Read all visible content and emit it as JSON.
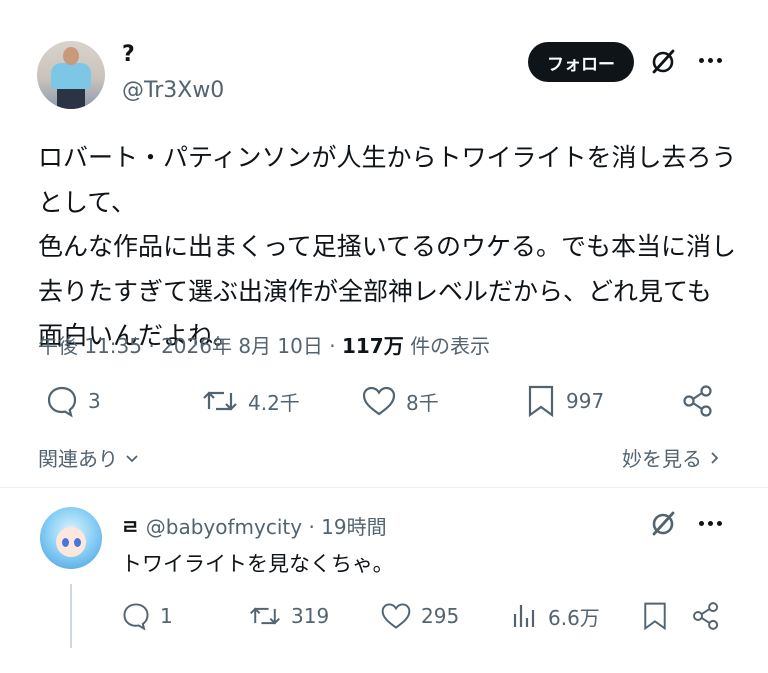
{
  "tweet": {
    "author_name": "?",
    "author_handle": "@Tr3Xw0",
    "follow_label": "フォロー",
    "text": "ロバート・パティンソンが人生からトワイライトを消し去ろうとして、\n色んな作品に出まくって足掻いてるのウケる。でも本当に消し\n去りたすぎて選ぶ出演作が全部神レベルだから、どれ見ても\n面白いんだよね。",
    "time": "午後 11:35",
    "date": "2026年 8月 10日",
    "views_count": "117万",
    "views_label": "件の表示",
    "actions": {
      "replies": "3",
      "reposts": "4.2千",
      "likes": "8千",
      "bookmarks": "997"
    },
    "related_label": "関連あり",
    "show_more_label": "妙を見る"
  },
  "reply": {
    "display_name": "ㄹ",
    "handle": "@babyofmycity",
    "time": "19時間",
    "text": "トワイライトを見なくちゃ。",
    "actions": {
      "replies": "1",
      "reposts": "319",
      "likes": "295",
      "views": "6.6万"
    }
  },
  "icons": {
    "grok": "grok-icon",
    "more": "more-icon",
    "reply": "comment-icon",
    "repost": "repost-icon",
    "like": "heart-icon",
    "bookmark": "bookmark-icon",
    "share": "share-icon",
    "analytics": "analytics-icon",
    "chevron": "chevron-icon"
  },
  "colors": {
    "text": "#0f1419",
    "secondary": "#536471",
    "follow_button": "#0f1419",
    "divider": "#eff3f4"
  }
}
